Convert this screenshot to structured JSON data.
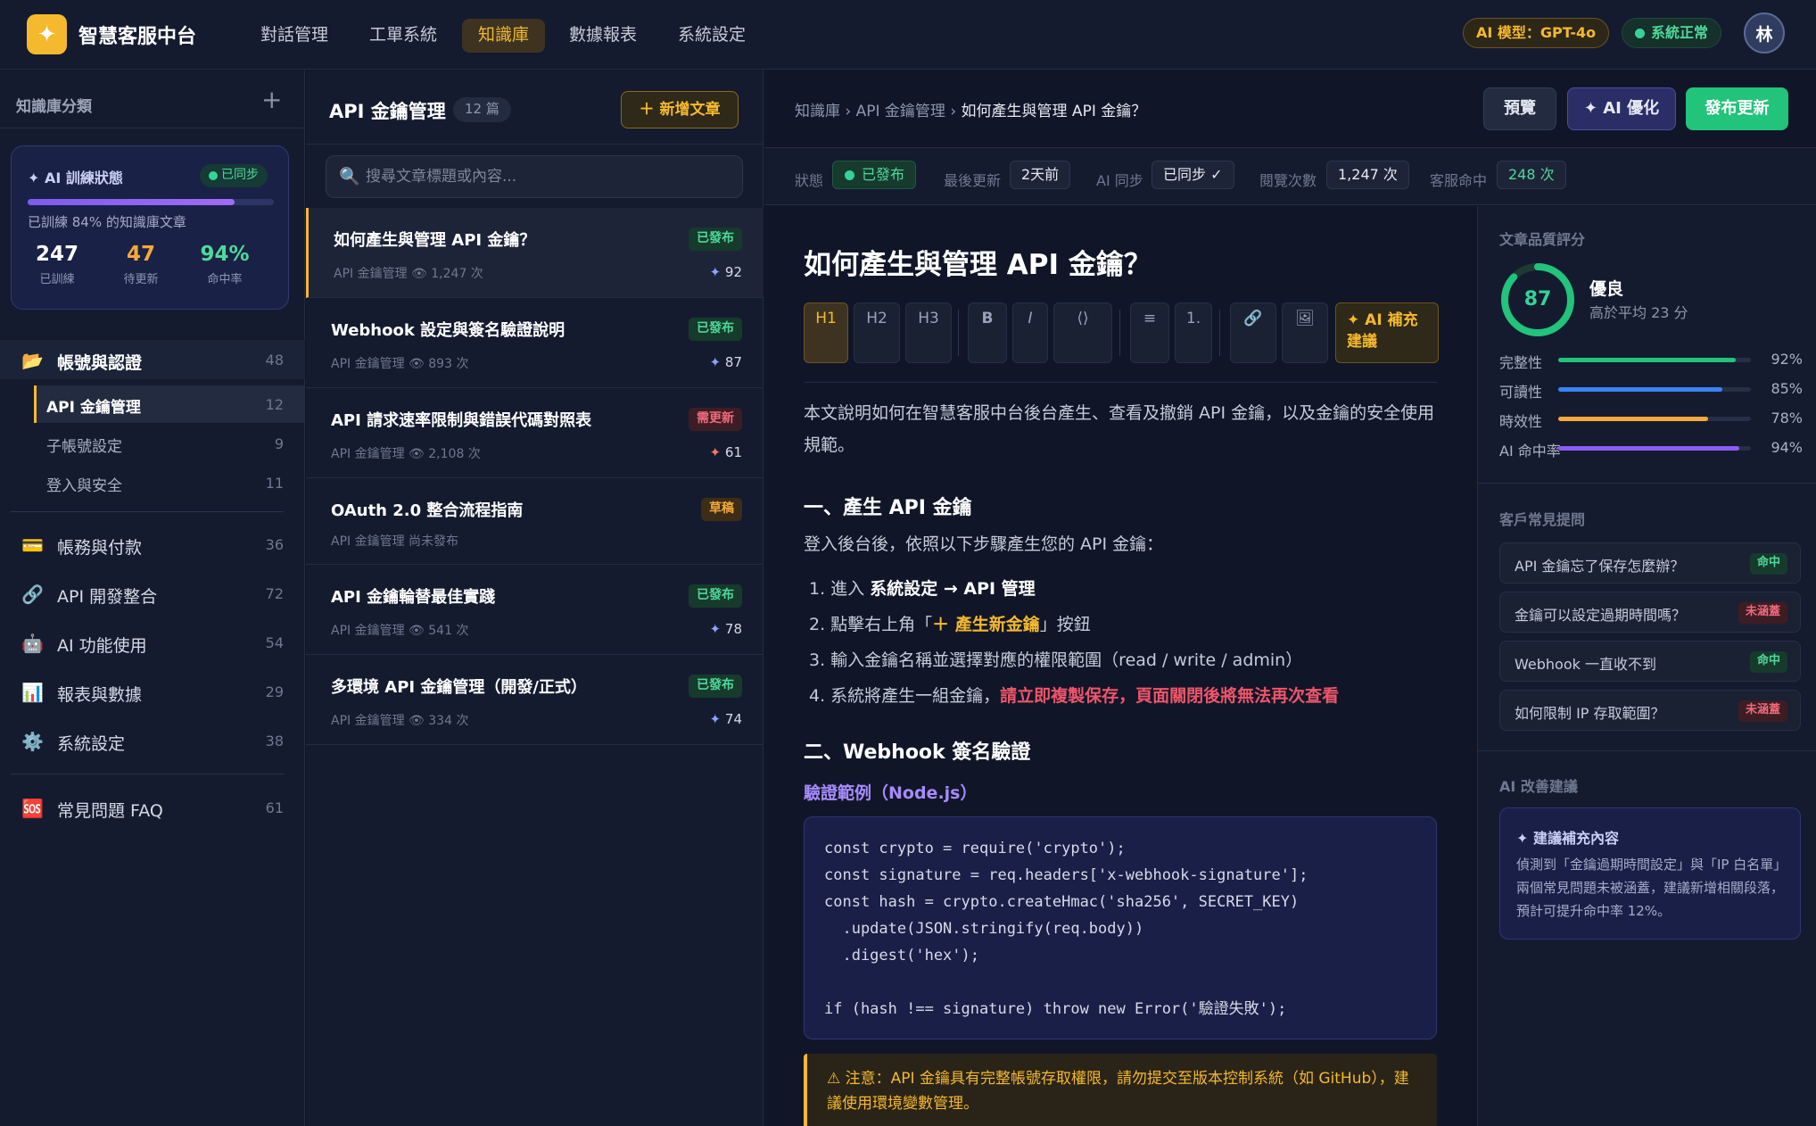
{
  "app": {
    "logo_icon": "✦",
    "name": "智慧客服中台"
  },
  "nav": [
    {
      "label": "對話管理",
      "active": false
    },
    {
      "label": "工單系統",
      "active": false
    },
    {
      "label": "知識庫",
      "active": true
    },
    {
      "label": "數據報表",
      "active": false
    },
    {
      "label": "系統設定",
      "active": false
    }
  ],
  "header": {
    "model_label": "AI 模型：GPT-4o",
    "status_label": "系統正常",
    "avatar_initial": "林"
  },
  "sidebar": {
    "title": "知識庫分類",
    "add_icon": "+",
    "ai_card": {
      "title": "✦  AI 訓練狀態",
      "badge": "已同步",
      "progress": 0.84,
      "desc": "已訓練 84% 的知識庫文章",
      "stats": [
        {
          "value": "247",
          "label": "已訓練",
          "color": "#ffffff"
        },
        {
          "value": "47",
          "label": "待更新",
          "color": "#f5a93a"
        },
        {
          "value": "94%",
          "label": "命中率",
          "color": "#4fd89b"
        }
      ]
    },
    "group": {
      "icon": "📂",
      "label": "帳號與認證",
      "count": "48"
    },
    "subs": [
      {
        "label": "API 金鑰管理",
        "count": "12",
        "active": true
      },
      {
        "label": "子帳號設定",
        "count": "9",
        "active": false
      },
      {
        "label": "登入與安全",
        "count": "11",
        "active": false
      }
    ],
    "categories": [
      {
        "icon": "💳",
        "label": "帳務與付款",
        "count": "36"
      },
      {
        "icon": "🔗",
        "label": "API 開發整合",
        "count": "72"
      },
      {
        "icon": "🤖",
        "label": "AI 功能使用",
        "count": "54"
      },
      {
        "icon": "📊",
        "label": "報表與數據",
        "count": "29"
      },
      {
        "icon": "⚙️",
        "label": "系統設定",
        "count": "38"
      }
    ],
    "faq": {
      "icon": "🆘",
      "label": "常見問題 FAQ",
      "count": "61"
    }
  },
  "list": {
    "title": "API 金鑰管理",
    "count": "12 篇",
    "new_button": "＋ 新增文章",
    "search_placeholder": "搜尋文章標題或內容...",
    "articles": [
      {
        "title": "如何產生與管理 API 金鑰？",
        "meta": "API 金鑰管理   👁 1,247 次",
        "tag": "已發布",
        "tag_type": "pub",
        "score": "92",
        "score_icon": "✦",
        "active": true
      },
      {
        "title": "Webhook 設定與簽名驗證說明",
        "meta": "API 金鑰管理   👁 893 次",
        "tag": "已發布",
        "tag_type": "pub",
        "score": "87",
        "score_icon": "✦",
        "active": false
      },
      {
        "title": "API 請求速率限制與錯誤代碼對照表",
        "meta": "API 金鑰管理   👁 2,108 次",
        "tag": "需更新",
        "tag_type": "upd",
        "score": "61",
        "score_icon": "✦",
        "active": false
      },
      {
        "title": "OAuth 2.0 整合流程指南",
        "meta": "API 金鑰管理   尚未發布",
        "tag": "草稿",
        "tag_type": "draft",
        "score": "",
        "score_icon": "",
        "active": false
      },
      {
        "title": "API 金鑰輪替最佳實踐",
        "meta": "API 金鑰管理   👁 541 次",
        "tag": "已發布",
        "tag_type": "pub",
        "score": "78",
        "score_icon": "✦",
        "active": false
      },
      {
        "title": "多環境 API 金鑰管理（開發/正式）",
        "meta": "API 金鑰管理   👁 334 次",
        "tag": "已發布",
        "tag_type": "pub",
        "score": "74",
        "score_icon": "✦",
        "active": false
      }
    ]
  },
  "content": {
    "breadcrumb": {
      "p1": "知識庫",
      "sep": " › ",
      "p2": "API 金鑰管理",
      "current": "如何產生與管理 API 金鑰？"
    },
    "buttons": {
      "preview": "預覽",
      "ai_optimize": "✦ AI 優化",
      "publish": "發布更新"
    },
    "meta": {
      "status_label": "狀態",
      "status_value": "已發布",
      "updated_label": "最後更新",
      "updated_value": "2天前",
      "sync_label": "AI 同步",
      "sync_value": "已同步 ✓",
      "views_label": "閱覽次數",
      "views_value": "1,247 次",
      "hits_label": "客服命中",
      "hits_value": "248 次"
    },
    "title": "如何產生與管理 API 金鑰？",
    "toolbar": {
      "h1": "H1",
      "h2": "H2",
      "h3": "H3",
      "bold": "B",
      "italic": "I",
      "code": "⟨⟩",
      "ul": "≡",
      "ol": "1.",
      "link_icon": "🔗",
      "image_icon": "🖼",
      "ai_fill_1": "✦ AI 補充",
      "ai_fill_2": "建議"
    },
    "intro": "本文說明如何在智慧客服中台後台產生、查看及撤銷 API 金鑰，以及金鑰的安全使用規範。",
    "section1": "一、產生 API 金鑰",
    "step_intro": "登入後台後，依照以下步驟產生您的 API 金鑰：",
    "steps": {
      "s1_pre": "1. 進入 ",
      "s1_bold": "系統設定 → API 管理",
      "s2_pre": "2. 點擊右上角「",
      "s2_gold": "＋ 產生新金鑰",
      "s2_post": "」按鈕",
      "s3": "3. 輸入金鑰名稱並選擇對應的權限範圍（read / write / admin）",
      "s4_pre": "4. 系統將產生一組金鑰，",
      "s4_red": "請立即複製保存，頁面關閉後將無法再次查看"
    },
    "section2": "二、Webhook 簽名驗證",
    "code_title": "驗證範例（Node.js）",
    "code": "const crypto = require('crypto');\nconst signature = req.headers['x-webhook-signature'];\nconst hash = crypto.createHmac('sha256', SECRET_KEY)\n  .update(JSON.stringify(req.body))\n  .digest('hex');\n\nif (hash !== signature) throw new Error('驗證失敗');",
    "warning": "⚠ 注意：API 金鑰具有完整帳號存取權限，請勿提交至版本控制系統（如 GitHub），建議使用環境變數管理。"
  },
  "quality": {
    "title": "文章品質評分",
    "score": "87",
    "score_fraction": 0.87,
    "grade": "優良",
    "grade_sub": "高於平均 23 分",
    "rows": [
      {
        "label": "完整性",
        "pct": "92%",
        "value": 0.92,
        "color": "#22c37a"
      },
      {
        "label": "可讀性",
        "pct": "85%",
        "value": 0.85,
        "color": "#3b82f6"
      },
      {
        "label": "時效性",
        "pct": "78%",
        "value": 0.78,
        "color": "#f5a93a"
      },
      {
        "label": "AI 命中率",
        "pct": "94%",
        "value": 0.94,
        "color": "#8b5cf6"
      }
    ]
  },
  "faq": {
    "title": "客戶常見提問",
    "items": [
      {
        "q": "API 金鑰忘了保存怎麼辦？",
        "badge": "命中",
        "type": "hit"
      },
      {
        "q": "金鑰可以設定過期時間嗎？",
        "badge": "未涵蓋",
        "type": "miss"
      },
      {
        "q": "Webhook 一直收不到",
        "badge": "命中",
        "type": "hit"
      },
      {
        "q": "如何限制 IP 存取範圍？",
        "badge": "未涵蓋",
        "type": "miss"
      }
    ]
  },
  "suggest": {
    "title": "AI 改善建議",
    "card_title": "✦  建議補充內容",
    "card_desc": "偵測到「金鑰過期時間設定」與「IP 白名單」兩個常見問題未被涵蓋，建議新增相關段落，預計可提升命中率 12%。"
  }
}
